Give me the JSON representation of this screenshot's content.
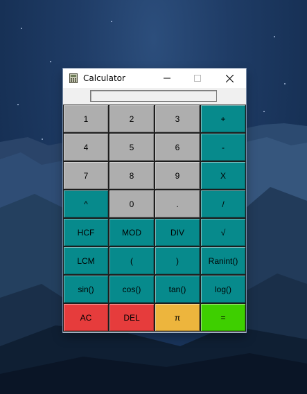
{
  "window": {
    "title": "Calculator",
    "display_value": ""
  },
  "colors": {
    "gray": "#aeaeae",
    "teal": "#078a8c",
    "red": "#e63c3c",
    "yellow": "#edb53d",
    "green": "#3ecf00"
  },
  "keys": [
    {
      "label": "1",
      "name": "key-1",
      "color": "gray"
    },
    {
      "label": "2",
      "name": "key-2",
      "color": "gray"
    },
    {
      "label": "3",
      "name": "key-3",
      "color": "gray"
    },
    {
      "label": "+",
      "name": "key-plus",
      "color": "teal"
    },
    {
      "label": "4",
      "name": "key-4",
      "color": "gray"
    },
    {
      "label": "5",
      "name": "key-5",
      "color": "gray"
    },
    {
      "label": "6",
      "name": "key-6",
      "color": "gray"
    },
    {
      "label": "-",
      "name": "key-minus",
      "color": "teal"
    },
    {
      "label": "7",
      "name": "key-7",
      "color": "gray"
    },
    {
      "label": "8",
      "name": "key-8",
      "color": "gray"
    },
    {
      "label": "9",
      "name": "key-9",
      "color": "gray"
    },
    {
      "label": "X",
      "name": "key-multiply",
      "color": "teal"
    },
    {
      "label": "^",
      "name": "key-power",
      "color": "teal"
    },
    {
      "label": "0",
      "name": "key-0",
      "color": "gray"
    },
    {
      "label": ".",
      "name": "key-decimal",
      "color": "gray"
    },
    {
      "label": "/",
      "name": "key-divide",
      "color": "teal"
    },
    {
      "label": "HCF",
      "name": "key-hcf",
      "color": "teal"
    },
    {
      "label": "MOD",
      "name": "key-mod",
      "color": "teal"
    },
    {
      "label": "DIV",
      "name": "key-div",
      "color": "teal"
    },
    {
      "label": "√",
      "name": "key-sqrt",
      "color": "teal"
    },
    {
      "label": "LCM",
      "name": "key-lcm",
      "color": "teal"
    },
    {
      "label": "(",
      "name": "key-open-paren",
      "color": "teal"
    },
    {
      "label": ")",
      "name": "key-close-paren",
      "color": "teal"
    },
    {
      "label": "Ranint()",
      "name": "key-ranint",
      "color": "teal"
    },
    {
      "label": "sin()",
      "name": "key-sin",
      "color": "teal"
    },
    {
      "label": "cos()",
      "name": "key-cos",
      "color": "teal"
    },
    {
      "label": "tan()",
      "name": "key-tan",
      "color": "teal"
    },
    {
      "label": "log()",
      "name": "key-log",
      "color": "teal"
    },
    {
      "label": "AC",
      "name": "key-all-clear",
      "color": "red"
    },
    {
      "label": "DEL",
      "name": "key-delete",
      "color": "red"
    },
    {
      "label": "π",
      "name": "key-pi",
      "color": "yellow"
    },
    {
      "label": "=",
      "name": "key-equals",
      "color": "green"
    }
  ]
}
